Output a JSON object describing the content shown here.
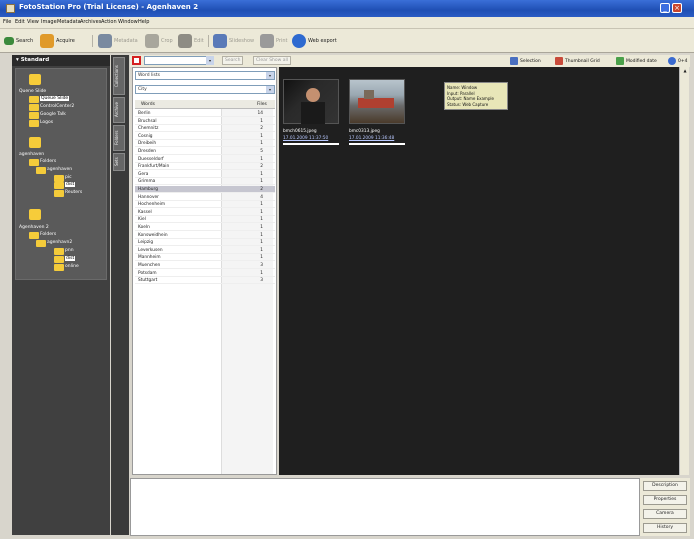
{
  "window": {
    "title": "FotoStation Pro (Trial License) - Agenhaven 2",
    "min": "_",
    "max": "□",
    "close": "×"
  },
  "menu": [
    "File",
    "Edit",
    "View",
    "Image",
    "Metadata",
    "Archives",
    "Action",
    "Window",
    "Help"
  ],
  "toolbar": {
    "search": "Search",
    "acquire": "Acquire",
    "metadata": "Metadata",
    "crop": "Crop",
    "edit": "Edit",
    "slideshow": "Slideshow",
    "print": "Print",
    "web_export": "Web export"
  },
  "left_panel": {
    "header": "Standard",
    "tabs": [
      "Collections",
      "Archive",
      "Folders",
      "Sets"
    ],
    "groups": [
      {
        "root": "Quene Slide",
        "children": [
          "Queue Slide",
          "ControlCenter2",
          "Google Talk",
          "Logos"
        ]
      },
      {
        "root": "agenhaven",
        "children": [
          "Folders",
          "agenhaven",
          "pic",
          "dist",
          "Reuters"
        ]
      },
      {
        "root": "Agenhaven 2",
        "children": [
          "Folders",
          "agenhavn2",
          "pnn",
          "dist",
          "online"
        ]
      }
    ]
  },
  "search_bar": {
    "input_value": "",
    "search_btn": "Search",
    "clear_btn": "Clear Show all",
    "selection": "Selection",
    "thumb_grid": "Thumbnail Grid",
    "modified": "Modified date",
    "count": "0+4"
  },
  "filter": {
    "field1": "Word lists",
    "field2": "City",
    "col_words": "Words",
    "col_files": "Files",
    "rows": [
      {
        "word": "Berlin",
        "files": "14"
      },
      {
        "word": "Bruchsal",
        "files": "1"
      },
      {
        "word": "Chemnitz",
        "files": "2"
      },
      {
        "word": "Cosnig",
        "files": "1"
      },
      {
        "word": "Dreibeih",
        "files": "1"
      },
      {
        "word": "Dresden",
        "files": "5"
      },
      {
        "word": "Duesseldorf",
        "files": "1"
      },
      {
        "word": "Frankfurt/Main",
        "files": "2"
      },
      {
        "word": "Gera",
        "files": "1"
      },
      {
        "word": "Grimma",
        "files": "1"
      },
      {
        "word": "Hamburg",
        "files": "2"
      },
      {
        "word": "Hannover",
        "files": "4"
      },
      {
        "word": "Hochenheim",
        "files": "1"
      },
      {
        "word": "Kassel",
        "files": "1"
      },
      {
        "word": "Kiel",
        "files": "1"
      },
      {
        "word": "Koeln",
        "files": "1"
      },
      {
        "word": "Konsweidhein",
        "files": "1"
      },
      {
        "word": "Leipzig",
        "files": "1"
      },
      {
        "word": "Leverkusen",
        "files": "1"
      },
      {
        "word": "Mannheim",
        "files": "1"
      },
      {
        "word": "Muenchen",
        "files": "3"
      },
      {
        "word": "Potsdam",
        "files": "1"
      },
      {
        "word": "Stuttgart",
        "files": "3"
      }
    ],
    "selected_index": 10
  },
  "thumbnails": [
    {
      "name": "bmch0615.jpeg",
      "date": "17.01.2009 11:37:50"
    },
    {
      "name": "bmc0313.jpeg",
      "date": "17.01.2009 11:36:48"
    }
  ],
  "tooltip": {
    "lines": [
      "Name: Window",
      "Input: Parallel",
      "Output: Name Example",
      "Status: Web Capture"
    ]
  },
  "side_buttons": [
    "Description",
    "Properties",
    "Camera",
    "History"
  ]
}
